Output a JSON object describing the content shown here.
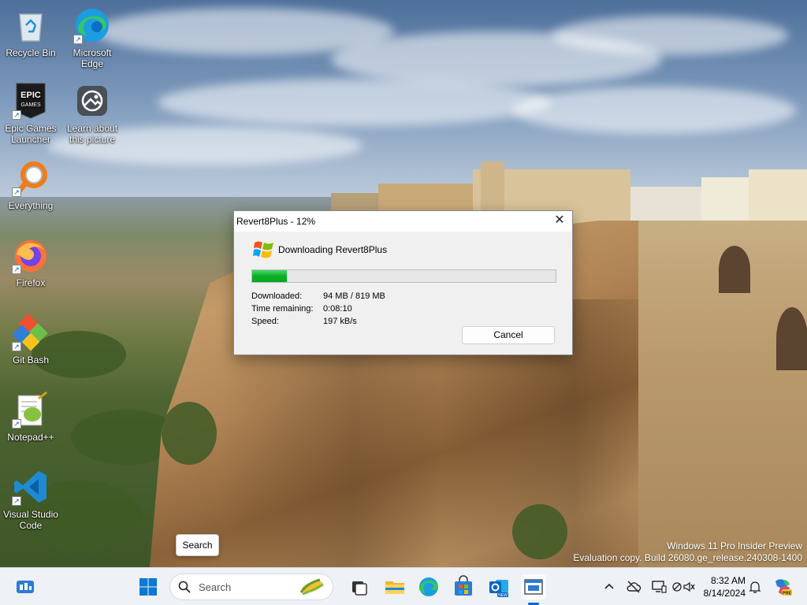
{
  "desktop": {
    "icons": [
      {
        "label": "Recycle Bin",
        "icon": "recycle-bin-icon"
      },
      {
        "label": "Microsoft Edge",
        "icon": "edge-icon"
      },
      {
        "label": "Epic Games Launcher",
        "icon": "epic-games-icon"
      },
      {
        "label": "Learn about this picture",
        "icon": "learn-picture-icon"
      },
      {
        "label": "Everything",
        "icon": "everything-search-icon"
      },
      {
        "label": "Firefox",
        "icon": "firefox-icon"
      },
      {
        "label": "Git Bash",
        "icon": "git-bash-icon"
      },
      {
        "label": "Notepad++",
        "icon": "notepadpp-icon"
      },
      {
        "label": "Visual Studio Code",
        "icon": "vscode-icon"
      }
    ],
    "watermark": {
      "line1": "Windows 11 Pro Insider Preview",
      "line2": "Evaluation copy. Build 26080.ge_release.240308-1400"
    },
    "tooltip": "Search"
  },
  "dialog": {
    "title": "Revert8Plus - 12%",
    "close_glyph": "✕",
    "heading": "Downloading Revert8Plus",
    "progress": 0.115,
    "fields": [
      {
        "label": "Downloaded:",
        "value": "94 MB / 819 MB"
      },
      {
        "label": "Time remaining:",
        "value": "0:08:10"
      },
      {
        "label": "Speed:",
        "value": "197 kB/s"
      }
    ],
    "cancel_label": "Cancel"
  },
  "taskbar": {
    "search_placeholder": "Search",
    "pinned": [
      "widgets-icon",
      "start-icon",
      "task-view-icon",
      "file-explorer-icon",
      "edge-icon",
      "microsoft-store-icon",
      "outlook-new-icon",
      "revert8plus-app-icon"
    ],
    "tray": [
      "chevron-up-icon",
      "cloud-offline-icon",
      "display-icon",
      "network-volume-icon",
      "notification-icon",
      "copilot-pre-icon"
    ],
    "time": "8:32 AM",
    "date": "8/14/2024"
  },
  "colors": {
    "progress_green": "#06b025",
    "taskbar_bg": "#eef1f5",
    "dialog_bg": "#f0f0f0"
  }
}
